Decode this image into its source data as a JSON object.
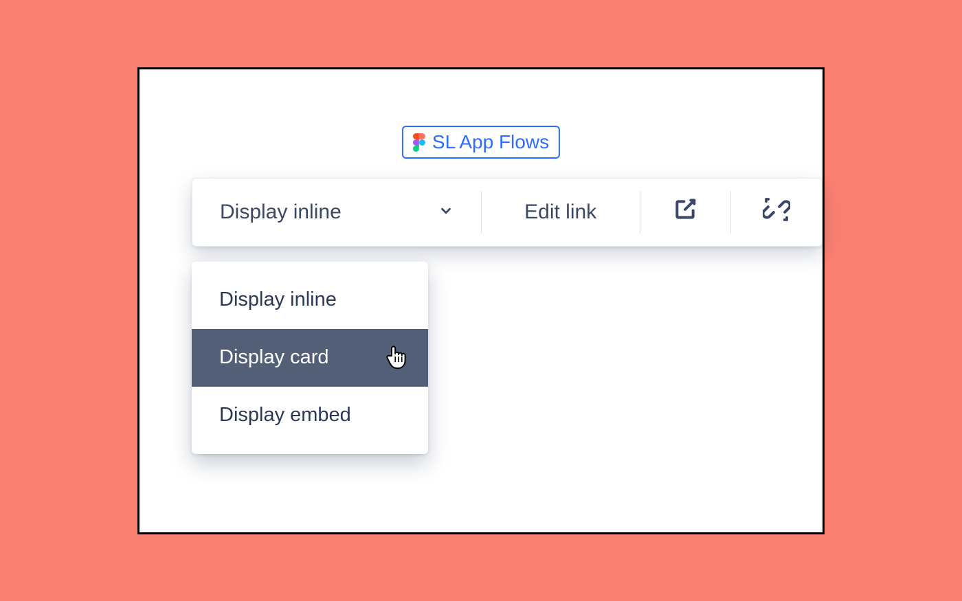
{
  "chip": {
    "label": "SL App Flows",
    "icon": "figma-logo"
  },
  "toolbar": {
    "display_select": {
      "label": "Display inline"
    },
    "edit_link_label": "Edit link",
    "open_icon": "open-external-icon",
    "unlink_icon": "unlink-icon"
  },
  "dropdown": {
    "options": [
      {
        "label": "Display inline"
      },
      {
        "label": "Display card"
      },
      {
        "label": "Display embed"
      }
    ],
    "hover_index": 1
  }
}
